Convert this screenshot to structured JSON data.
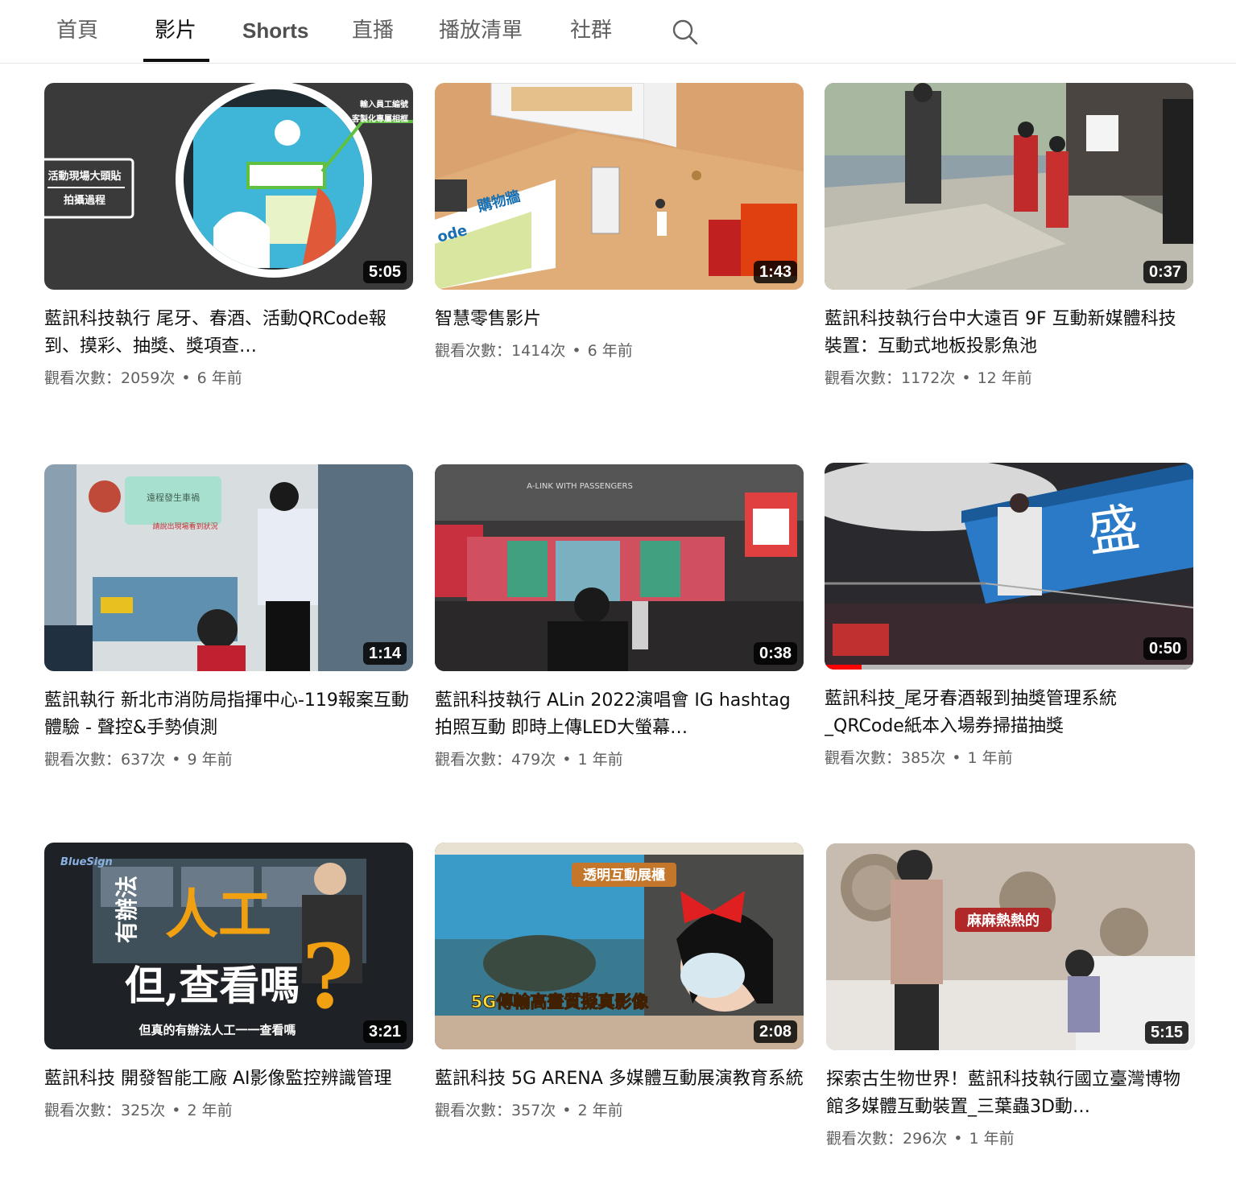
{
  "tabs": [
    {
      "label": "首頁",
      "active": false
    },
    {
      "label": "影片",
      "active": true
    },
    {
      "label": "Shorts",
      "active": false
    },
    {
      "label": "直播",
      "active": false
    },
    {
      "label": "播放清單",
      "active": false
    },
    {
      "label": "社群",
      "active": false
    }
  ],
  "search_icon": "search-icon",
  "videos": [
    {
      "title": "藍訊科技執行 尾牙、春酒、活動QRCode報到、摸彩、抽獎、獎項查…",
      "views": "觀看次數：2059次",
      "age": "6 年前",
      "duration": "5:05"
    },
    {
      "title": "智慧零售影片",
      "views": "觀看次數：1414次",
      "age": "6 年前",
      "duration": "1:43"
    },
    {
      "title": "藍訊科技執行台中大遠百 9F 互動新媒體科技裝置：互動式地板投影魚池",
      "views": "觀看次數：1172次",
      "age": "12 年前",
      "duration": "0:37"
    },
    {
      "title": "藍訊執行 新北市消防局指揮中心-119報案互動體驗 - 聲控&手勢偵測",
      "views": "觀看次數：637次",
      "age": "9 年前",
      "duration": "1:14"
    },
    {
      "title": "藍訊科技執行 ALin 2022演唱會 IG hashtag拍照互動 即時上傳LED大螢幕…",
      "views": "觀看次數：479次",
      "age": "1 年前",
      "duration": "0:38"
    },
    {
      "title": "藍訊科技_尾牙春酒報到抽獎管理系統_QRCode紙本入場券掃描抽獎",
      "views": "觀看次數：385次",
      "age": "1 年前",
      "duration": "0:50",
      "watched_fraction": 0.1
    },
    {
      "title": "藍訊科技 開發智能工廠 AI影像監控辨識管理",
      "views": "觀看次數：325次",
      "age": "2 年前",
      "duration": "3:21"
    },
    {
      "title": "藍訊科技 5G ARENA 多媒體互動展演教育系統",
      "views": "觀看次數：357次",
      "age": "2 年前",
      "duration": "2:08"
    },
    {
      "title": "探索古生物世界！藍訊科技執行國立臺灣博物館多媒體互動裝置_三葉蟲3D動…",
      "views": "觀看次數：296次",
      "age": "1 年前",
      "duration": "5:15"
    }
  ],
  "thumb_text": {
    "v1_label1": "輸入員工編號",
    "v1_label2": "客製化專屬相框",
    "v1_box1": "活動現場大頭貼",
    "v1_box2": "拍攝過程",
    "v2_sign": "購物牆",
    "v2_code": "ode",
    "v4_sign": "遠程發生車禍",
    "v4_sub": "請說出現場看到狀況",
    "v5_banner": "A-LINK WITH PASSENGERS",
    "v7_logo": "BlueSign",
    "v7_big1": "人工",
    "v7_side": "有辦法",
    "v7_big2": "但,查看嗎",
    "v7_q": "?",
    "v7_sub": "但真的有辦法人工一一查看嗎",
    "v8_top": "透明互動展櫃",
    "v8_bottom": "5G傳輸高畫質擬真影像",
    "v9_tag": "麻麻熱熱的",
    "v6_sign": "盛"
  }
}
